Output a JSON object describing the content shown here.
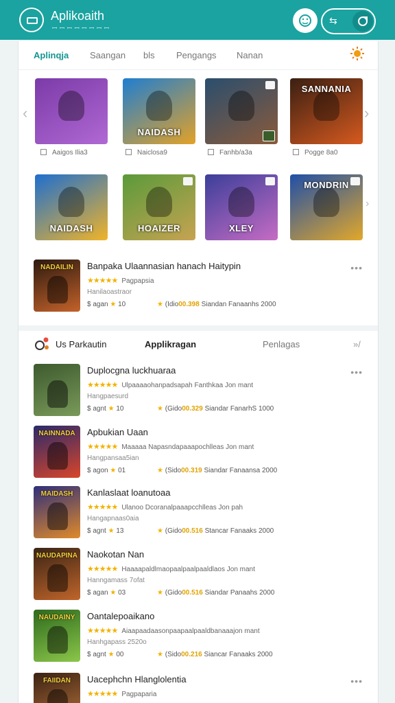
{
  "header": {
    "title": "Aplikoaith",
    "subtitle": "ꟷ ꟷ ꟷ ꟷ ꟷ ꟷ ꟷ ꟷ",
    "pill_icon": "⇆"
  },
  "tabs": [
    "Aplinqja",
    "Saangan",
    "bls",
    "Pengangs",
    "Nanan"
  ],
  "carousel": {
    "tiles": [
      {
        "label": "",
        "caption": "Aaigos Ilia3",
        "colors": [
          "#7b3ba8",
          "#b068d4"
        ]
      },
      {
        "label": "NAIDASH",
        "caption": "Naiclosa9",
        "colors": [
          "#1f7ed1",
          "#e3a227"
        ]
      },
      {
        "label": "",
        "caption": "Fanhb/a3a",
        "colors": [
          "#2a4e6e",
          "#8b5a3a"
        ]
      },
      {
        "label": "SANNANIA",
        "caption": "Pogge 8a0",
        "colors": [
          "#3a1f12",
          "#d65a1f"
        ]
      },
      {
        "label": "NAIDASH",
        "caption": "",
        "colors": [
          "#1e6fcf",
          "#f0b429"
        ]
      },
      {
        "label": "HOAIZER",
        "caption": "",
        "colors": [
          "#5a9a3a",
          "#c7a352"
        ]
      },
      {
        "label": "XLEY",
        "caption": "",
        "colors": [
          "#3b3f9a",
          "#c66cc4"
        ]
      },
      {
        "label": "MONDRIN",
        "caption": "",
        "colors": [
          "#1f4fa8",
          "#e2a82a"
        ]
      }
    ]
  },
  "featured": {
    "title": "Banpaka Ulaannasian hanach Haitypin",
    "rating_label": "Pagpapsia",
    "desc": "Hanilaoastraor",
    "meta_left": "$ agan",
    "meta_rating": "10",
    "price_prefix": "(Idio",
    "price": "00.398",
    "price_suffix": "Siandan Fanaanhs 2000",
    "thumb_text": "NADAILIN"
  },
  "section": {
    "left": "Us Parkautin",
    "center": "Applikragan",
    "right": "Penlagas",
    "more": "»/"
  },
  "list": [
    {
      "title": "Duplocgna luckhuaraa",
      "rating_label": "Ulpaaaaohanpadsapah Fanthkaa Jon mant",
      "desc": "Hangpaesurd",
      "meta_left": "$ agnt",
      "meta_rating": "10",
      "price_prefix": "(Gido",
      "price": "00.329",
      "price_suffix": "Siandar FanarhS 1000",
      "thumb": [
        "#3d5a2e",
        "#7a9a5a"
      ],
      "thumb_text": ""
    },
    {
      "title": "Apbukian Uaan",
      "rating_label": "Maaaaa Napasndapaaapochlleas Jon mant",
      "desc": "Hangpansaa5ian",
      "meta_left": "$ agon",
      "meta_rating": "01",
      "price_prefix": "(Sido",
      "price": "00.319",
      "price_suffix": "Siandar Fanaansa 2000",
      "thumb": [
        "#2a2a6a",
        "#d9452a"
      ],
      "thumb_text": "NAINNADA"
    },
    {
      "title": "Kanlaslaat loanutoaa",
      "rating_label": "Ulanoo Dcoranalpaaapcchlleas Jon pah",
      "desc": "Hangapnaas0aia",
      "meta_left": "$ agnt",
      "meta_rating": "13",
      "price_prefix": "(Gido",
      "price": "00.516",
      "price_suffix": "Stancar Fanaaks 2000",
      "thumb": [
        "#2f2f7a",
        "#e08a2a"
      ],
      "thumb_text": "MAIDASH"
    },
    {
      "title": "Naokotan Nan",
      "rating_label": "Haaaapaldlmaopaalpaalpaaldlaos Jon mant",
      "desc": "Hanngamass 7ofat",
      "meta_left": "$ agan",
      "meta_rating": "03",
      "price_prefix": "(Gido",
      "price": "00.516",
      "price_suffix": "Siandar Panaahs 2000",
      "thumb": [
        "#3a2416",
        "#c0652a"
      ],
      "thumb_text": "NAUDAPINA"
    },
    {
      "title": "Oantalepoaikano",
      "rating_label": "Aiaapaadaasonpaapaalpaaldbanaaajon mant",
      "desc": "Hanhgapass 2520o",
      "meta_left": "$ agnt",
      "meta_rating": "00",
      "price_prefix": "(Sido",
      "price": "00.216",
      "price_suffix": "Siancar Fanaaks 2000",
      "thumb": [
        "#2e6a1e",
        "#8bc64a"
      ],
      "thumb_text": "NAUDAINY"
    },
    {
      "title": "Uacephchn Hlanglolentia",
      "rating_label": "Pagpaparia",
      "desc": "",
      "meta_left": "",
      "meta_rating": "",
      "price_prefix": "",
      "price": "",
      "price_suffix": "",
      "thumb": [
        "#3a2214",
        "#b7723a"
      ],
      "thumb_text": "FAIIDAN"
    }
  ],
  "colors": {
    "accent": "#1aa3a0",
    "star": "#f2b200",
    "price": "#e1a300"
  },
  "icons": {
    "sun": "sun-icon",
    "face": "face-icon",
    "swap": "swap-icon",
    "share": "share-icon"
  }
}
